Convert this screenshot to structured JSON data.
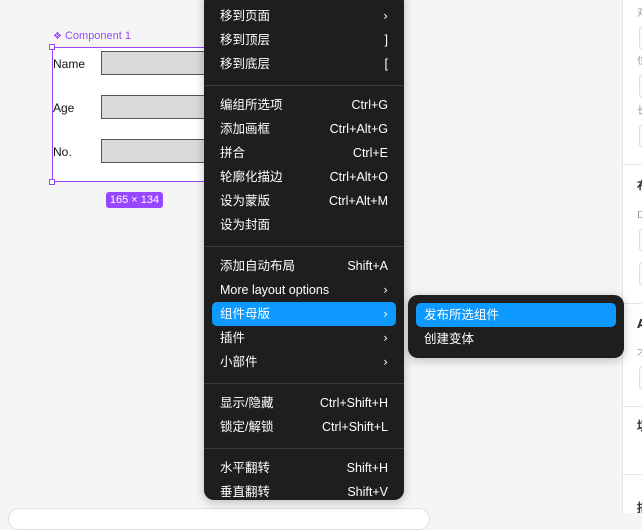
{
  "canvas": {
    "component": {
      "title": "Component 1",
      "size_label": "165 × 134",
      "fields": [
        {
          "label": "Name"
        },
        {
          "label": "Age"
        },
        {
          "label": "No."
        }
      ]
    }
  },
  "context_menu": {
    "items": [
      {
        "label": "移到页面",
        "shortcut": "",
        "has_submenu": true
      },
      {
        "label": "移到顶层",
        "shortcut": "]",
        "has_submenu": false
      },
      {
        "label": "移到底层",
        "shortcut": "[",
        "has_submenu": false
      },
      {
        "label": "编组所选项",
        "shortcut": "Ctrl+G",
        "has_submenu": false
      },
      {
        "label": "添加画框",
        "shortcut": "Ctrl+Alt+G",
        "has_submenu": false
      },
      {
        "label": "拼合",
        "shortcut": "Ctrl+E",
        "has_submenu": false
      },
      {
        "label": "轮廓化描边",
        "shortcut": "Ctrl+Alt+O",
        "has_submenu": false
      },
      {
        "label": "设为蒙版",
        "shortcut": "Ctrl+Alt+M",
        "has_submenu": false
      },
      {
        "label": "设为封面",
        "shortcut": "",
        "has_submenu": false
      },
      {
        "label": "添加自动布局",
        "shortcut": "Shift+A",
        "has_submenu": false
      },
      {
        "label": "More layout options",
        "shortcut": "",
        "has_submenu": true
      },
      {
        "label": "组件母版",
        "shortcut": "",
        "has_submenu": true,
        "active": true
      },
      {
        "label": "插件",
        "shortcut": "",
        "has_submenu": true
      },
      {
        "label": "小部件",
        "shortcut": "",
        "has_submenu": true
      },
      {
        "label": "显示/隐藏",
        "shortcut": "Ctrl+Shift+H",
        "has_submenu": false
      },
      {
        "label": "锁定/解锁",
        "shortcut": "Ctrl+Shift+L",
        "has_submenu": false
      },
      {
        "label": "水平翻转",
        "shortcut": "Shift+H",
        "has_submenu": false
      },
      {
        "label": "垂直翻转",
        "shortcut": "Shift+V",
        "has_submenu": false
      }
    ],
    "chevron_glyph": "›"
  },
  "submenu": {
    "items": [
      {
        "label": "发布所选组件",
        "active": true
      },
      {
        "label": "创建变体",
        "active": false
      }
    ]
  },
  "right_panel": {
    "glyphs": [
      "对",
      "位",
      "长",
      "布",
      "D",
      "A",
      "才",
      "填",
      "描"
    ]
  },
  "colors": {
    "accent": "#0d99ff",
    "component": "#9747ff",
    "menu_bg": "#1e1e1e"
  }
}
